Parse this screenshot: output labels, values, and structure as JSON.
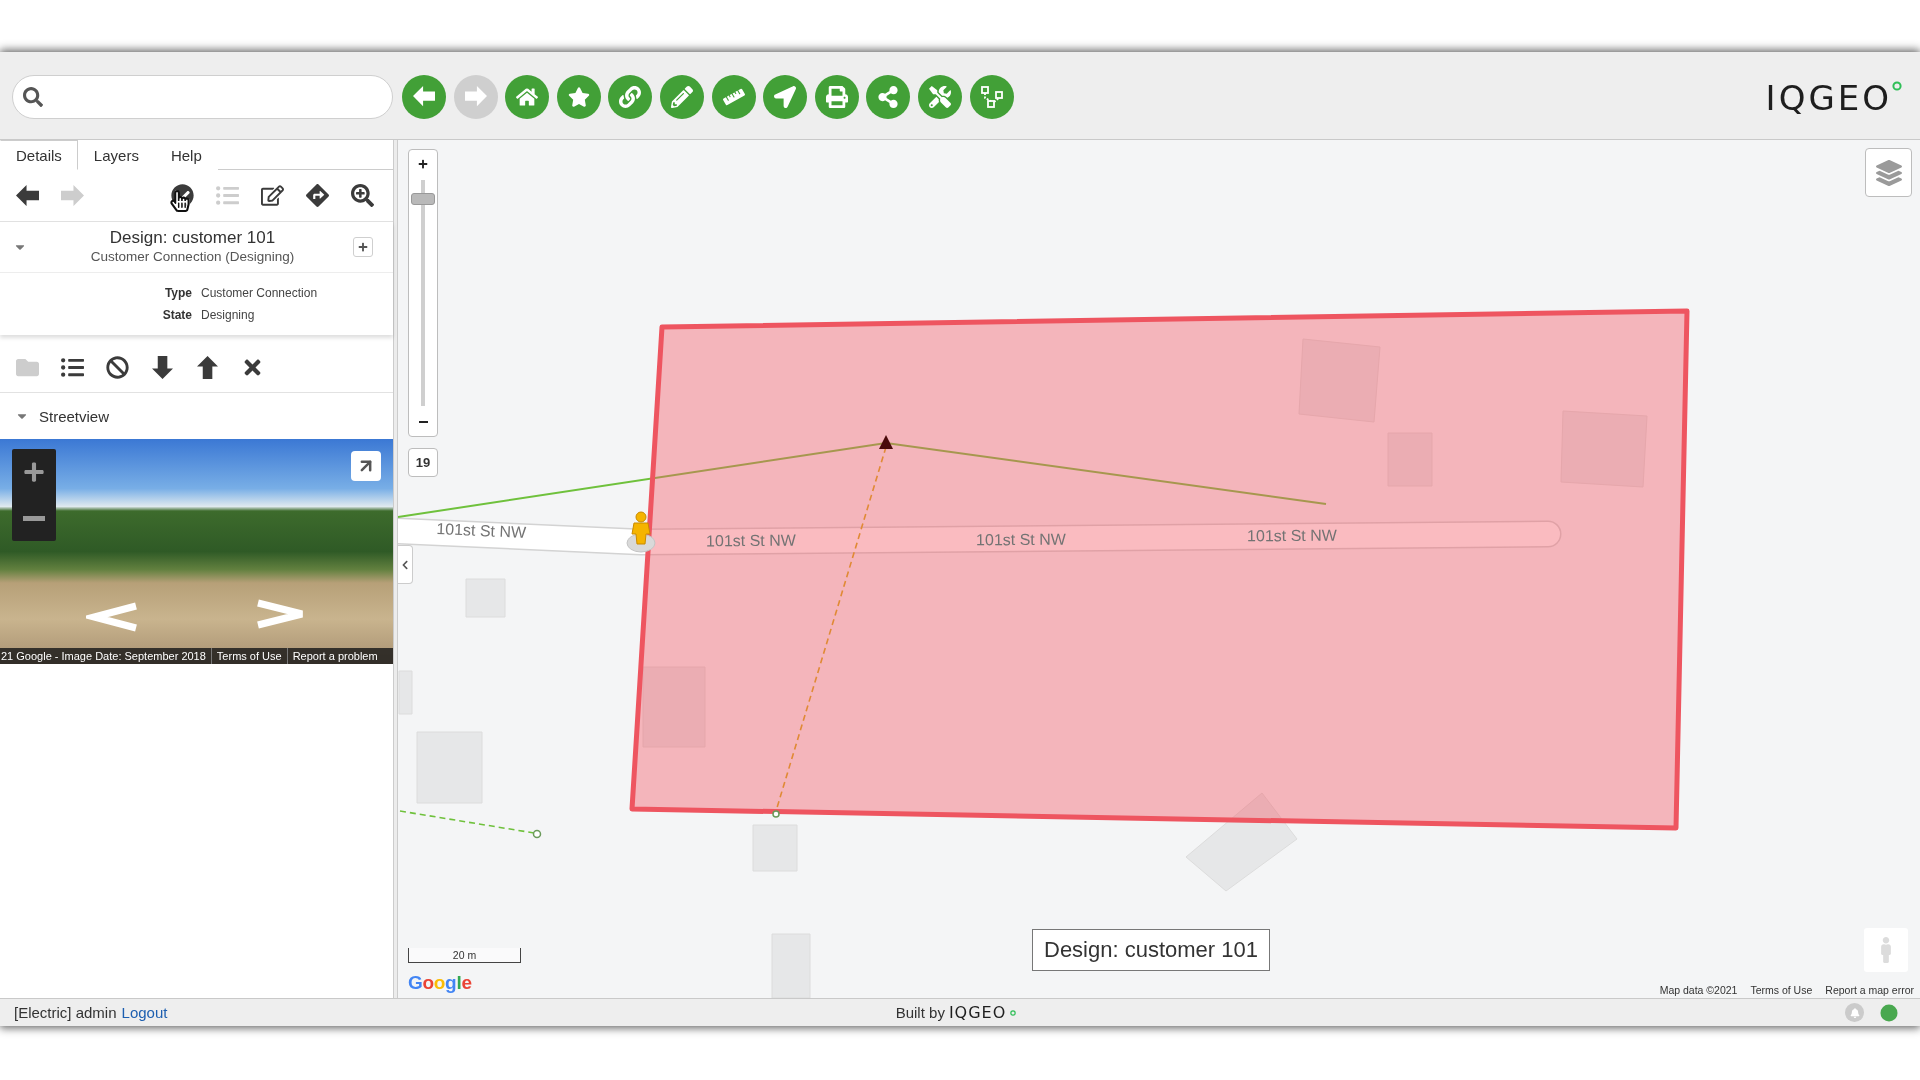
{
  "toolbar": {
    "buttons": [
      {
        "disabled": false
      },
      {
        "disabled": true
      },
      {
        "disabled": false
      },
      {
        "disabled": false
      },
      {
        "disabled": false
      },
      {
        "disabled": false
      },
      {
        "disabled": false
      },
      {
        "disabled": false
      },
      {
        "disabled": false
      },
      {
        "disabled": false
      },
      {
        "disabled": false
      },
      {
        "disabled": false
      }
    ]
  },
  "logo": "IQGEO",
  "left_panel": {
    "tabs": [
      {
        "label": "Details",
        "selected": true
      },
      {
        "label": "Layers",
        "selected": false
      },
      {
        "label": "Help",
        "selected": false
      }
    ],
    "details_toolbar": [
      {
        "disabled": false
      },
      {
        "disabled": true
      },
      {
        "disabled": false
      },
      {
        "disabled": true
      },
      {
        "disabled": false
      },
      {
        "disabled": false
      },
      {
        "disabled": false
      }
    ],
    "feature": {
      "title": "Design: customer 101",
      "subtitle": "Customer Connection (Designing)",
      "expanded": true,
      "properties": [
        {
          "label": "Type",
          "value": "Customer Connection"
        },
        {
          "label": "State",
          "value": "Designing"
        }
      ]
    },
    "feature_toolbar": [
      {
        "disabled": true
      },
      {
        "disabled": false
      },
      {
        "disabled": false
      },
      {
        "disabled": false
      },
      {
        "disabled": false
      },
      {
        "disabled": false
      }
    ],
    "streetview": {
      "title": "Streetview",
      "expanded": true,
      "attribution": [
        "21 Google - Image Date: September 2018",
        "Terms of Use",
        "Report a problem"
      ]
    }
  },
  "map": {
    "zoom": {
      "level": 0.94,
      "value": "19"
    },
    "road_labels": [
      "101st St NW",
      "101st St NW",
      "101st St NW",
      "101st St NW"
    ],
    "feature_label": "Design: customer 101",
    "scale": "20 m",
    "provider_logo": "Google",
    "attribution": [
      "Map data ©2021",
      "Terms of Use",
      "Report a map error"
    ]
  },
  "status_bar": {
    "user": "[Electric] admin",
    "logout": "Logout",
    "built_by": "Built by",
    "logo": "IQGEO"
  }
}
